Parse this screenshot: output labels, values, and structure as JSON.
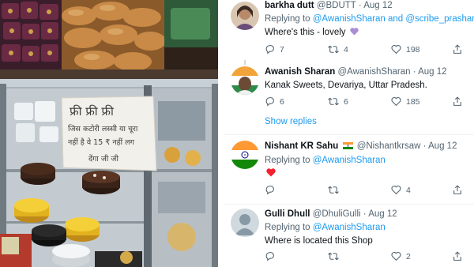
{
  "tweets": [
    {
      "name": "barkha dutt",
      "handle": "@BDUTT",
      "date": "Aug 12",
      "reply_prefix": "Replying to",
      "reply_to": "@AwanishSharan and @scribe_prashant",
      "text": "Where's this - lovely",
      "emoji": "purple-heart",
      "replies": "7",
      "retweets": "4",
      "likes": "198"
    },
    {
      "name": "Awanish Sharan",
      "handle": "@AwanishSharan",
      "date": "Aug 12",
      "text": "Kanak Sweets, Devariya, Uttar Pradesh.",
      "replies": "6",
      "retweets": "6",
      "likes": "185"
    },
    {
      "name": "Nishant KR Sahu",
      "handle": "@Nishantkrsaw",
      "date": "Aug 12",
      "reply_prefix": "Replying to",
      "reply_to": "@AwanishSharan",
      "emoji": "red-heart",
      "replies": "",
      "retweets": "",
      "likes": "4"
    },
    {
      "name": "Gulli Dhull",
      "handle": "@DhuliGulli",
      "date": "Aug 12",
      "reply_prefix": "Replying to",
      "reply_to": "@AwanishSharan",
      "text": "Where is located this Shop",
      "replies": "",
      "retweets": "",
      "likes": "2"
    }
  ],
  "show_replies": "Show replies",
  "dot": "·",
  "sign": {
    "line1": "फ्री फ्री फ्री",
    "line2": "जिस कटोरी लस्सी या चूरा",
    "line3": "नहीं है वे 15 ₹ नहीं लग",
    "line4": "देंगा जी जी"
  },
  "colors": {
    "link": "#1d9bf0",
    "secondary_text": "#536471",
    "heart_red": "#f4212e",
    "heart_purple": "#aa8ed6"
  }
}
